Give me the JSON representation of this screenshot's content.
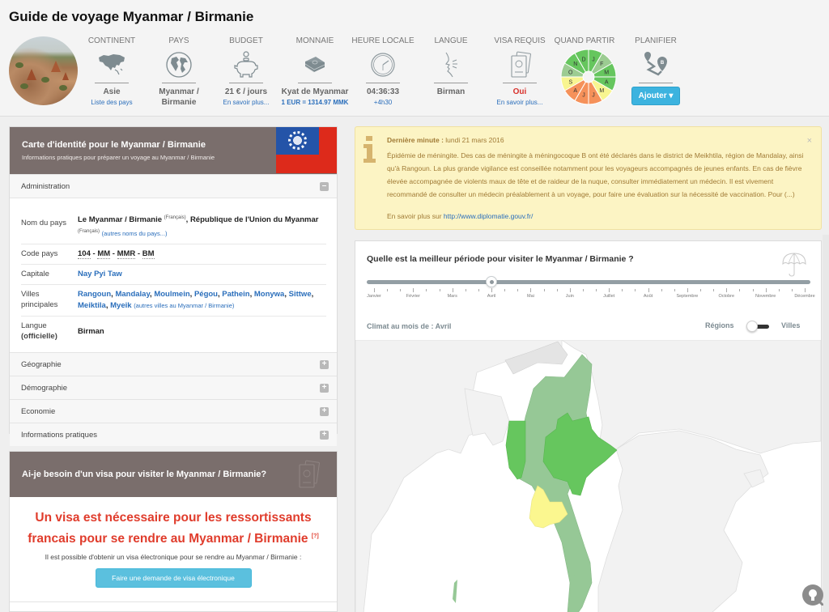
{
  "header": {
    "title": "Guide de voyage Myanmar / Birmanie",
    "stats": [
      {
        "key": "continent",
        "label": "CONTINENT",
        "icon": "asia-map-icon",
        "value": "Asie",
        "sub": "Liste des pays"
      },
      {
        "key": "pays",
        "label": "PAYS",
        "icon": "globe-icon",
        "value": "Myanmar / Birmanie",
        "sub": ""
      },
      {
        "key": "budget",
        "label": "BUDGET",
        "icon": "piggy-bank-icon",
        "value": "21 € / jours",
        "sub": "En savoir plus..."
      },
      {
        "key": "monnaie",
        "label": "MONNAIE",
        "icon": "banknotes-icon",
        "value": "Kyat de Myanmar",
        "sub": "1 EUR = 1314.97 MMK"
      },
      {
        "key": "heure",
        "label": "HEURE LOCALE",
        "icon": "clock-icon",
        "value": "04:36:33",
        "sub": "+4h30"
      },
      {
        "key": "langue",
        "label": "LANGUE",
        "icon": "speaking-head-icon",
        "value": "Birman",
        "sub": ""
      },
      {
        "key": "visa",
        "label": "VISA REQUIS",
        "icon": "passport-icon",
        "value": "Oui",
        "sub": "En savoir plus..."
      },
      {
        "key": "quand",
        "label": "QUAND PARTIR",
        "icon": "month-wheel",
        "value": "",
        "sub": ""
      },
      {
        "key": "planifier",
        "label": "PLANIFIER",
        "icon": "route-icon",
        "value": "",
        "sub": "",
        "button": "Ajouter ▾"
      }
    ],
    "wheel": [
      {
        "m": "J",
        "rating": "good"
      },
      {
        "m": "F",
        "rating": "fair"
      },
      {
        "m": "M",
        "rating": "good"
      },
      {
        "m": "A",
        "rating": "good"
      },
      {
        "m": "M",
        "rating": "average"
      },
      {
        "m": "J",
        "rating": "bad"
      },
      {
        "m": "J",
        "rating": "bad"
      },
      {
        "m": "A",
        "rating": "bad"
      },
      {
        "m": "S",
        "rating": "average"
      },
      {
        "m": "O",
        "rating": "fair"
      },
      {
        "m": "N",
        "rating": "good"
      },
      {
        "m": "D",
        "rating": "good"
      }
    ],
    "rating_colors": {
      "good": "#66c65e",
      "fair": "#9ccc92",
      "average": "#f8f590",
      "bad": "#f5915a"
    }
  },
  "id_card": {
    "title": "Carte d'identité pour le Myanmar / Birmanie",
    "subtitle": "Informations pratiques pour préparer un voyage au Myanmar / Birmanie",
    "sections": {
      "administration": "Administration",
      "geographie": "Géographie",
      "demographie": "Démographie",
      "economie": "Economie",
      "infos": "Informations pratiques"
    },
    "rows": {
      "nom_label": "Nom du pays",
      "nom_1": "Le Myanmar / Birmanie",
      "nom_lang": "(Français)",
      "nom_2": ", République de l'Union du Myanmar",
      "nom_lang2": "(Français)",
      "nom_more": "(autres noms du pays...)",
      "code_label": "Code pays",
      "code_values": [
        "104",
        "MM",
        "MMR",
        "BM"
      ],
      "capitale_label": "Capitale",
      "capitale": "Nay Pyi Taw",
      "villes_label": "Villes principales",
      "villes": [
        "Rangoun",
        "Mandalay",
        "Moulmein",
        "Pégou",
        "Pathein",
        "Monywa",
        "Sittwe",
        "Meiktila",
        "Myeik"
      ],
      "villes_more": "(autres villes au Myanmar / Birmanie)",
      "langue_label": "Langue",
      "langue_label2": "(officielle)",
      "langue": "Birman"
    }
  },
  "visa_card": {
    "title": "Ai-je besoin d'un visa pour visiter le Myanmar / Birmanie?",
    "headline": "Un visa est nécessaire pour les ressortissants francais pour se rendre au Myanmar / Birmanie",
    "help": "[?]",
    "note": "Il est possible d'obtenir un visa électronique pour se rendre au Myanmar / Birmanie :",
    "button": "Faire une demande de visa électronique"
  },
  "alert": {
    "title_bold": "Dernière minute :",
    "date": " lundi 21 mars 2016",
    "body": "Épidémie de méningite. Des cas de méningite à méningocoque B ont été déclarés dans le district de Meikhtila, région de Mandalay, ainsi qu'à Rangoun. La plus grande vigilance est conseillée notamment pour les voyageurs accompagnés de jeunes enfants. En cas de fièvre élevée accompagnée de violents maux de tête et de raideur de la nuque, consulter immédiatement un médecin. Il est vivement recommandé de consulter un médecin préalablement à un voyage, pour faire une évaluation sur la nécessité de vaccination. Pour (...)",
    "more_text": "En savoir plus sur ",
    "more_link": "http://www.diplomatie.gouv.fr/",
    "close": "×"
  },
  "climate": {
    "question": "Quelle est la meilleur période pour visiter le Myanmar / Birmanie ?",
    "months": [
      "Janvier",
      "Février",
      "Mars",
      "Avril",
      "Mai",
      "Juin",
      "Juillet",
      "Août",
      "Septembre",
      "Octobre",
      "Novembre",
      "Décembre"
    ],
    "selected_month_index": 3,
    "current_label": "Climat au mois de : Avril",
    "toggle_left": "Régions",
    "toggle_right": "Villes",
    "toggle_state": "Régions",
    "region_colors": {
      "good": "#66c65e",
      "fair": "#96c896",
      "average": "#fbf78f",
      "neighbor": "#f2f2f2",
      "sea": "#ffffff"
    }
  }
}
